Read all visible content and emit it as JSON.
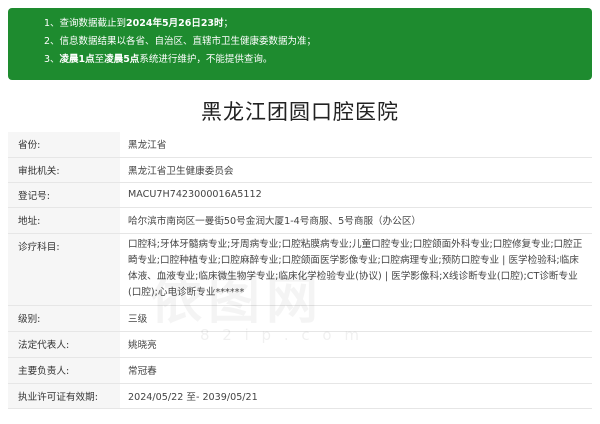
{
  "notice": {
    "line1_pre": "1、查询数据截止到",
    "line1_bold": "2024年5月26日23时",
    "line1_post": "；",
    "line2": "2、信息数据结果以各省、自治区、直辖市卫生健康委数据为准；",
    "line3_pre": "3、",
    "line3_bold1": "凌晨1点",
    "line3_mid": "至",
    "line3_bold2": "凌晨5点",
    "line3_post": "系统进行维护，不能提供查询。"
  },
  "title": "黑龙江团圆口腔医院",
  "rows": [
    {
      "key": "省份:",
      "value": "黑龙江省"
    },
    {
      "key": "审批机关:",
      "value": "黑龙江省卫生健康委员会"
    },
    {
      "key": "登记号:",
      "value": "MACU7H7423000016A5112"
    },
    {
      "key": "地址:",
      "value": "哈尔滨市南岗区一曼街50号金润大厦1-4号商服、5号商服（办公区）"
    },
    {
      "key": "诊疗科目:",
      "value": "口腔科;牙体牙髓病专业;牙周病专业;口腔粘膜病专业;儿童口腔专业;口腔颌面外科专业;口腔修复专业;口腔正畸专业;口腔种植专业;口腔麻醉专业;口腔颌面医学影像专业;口腔病理专业;预防口腔专业 | 医学检验科;临床体液、血液专业;临床微生物学专业;临床化学检验专业(协议) | 医学影像科;X线诊断专业(口腔);CT诊断专业(口腔);心电诊断专业******"
    },
    {
      "key": "级别:",
      "value": "三级"
    },
    {
      "key": "法定代表人:",
      "value": "姚晓亮"
    },
    {
      "key": "主要负责人:",
      "value": "常冠春"
    },
    {
      "key": "执业许可证有效期:",
      "value": "2024/05/22 至- 2039/05/21"
    }
  ],
  "watermark": {
    "main": "依图网",
    "sub": "8 2 i p . c o m"
  }
}
